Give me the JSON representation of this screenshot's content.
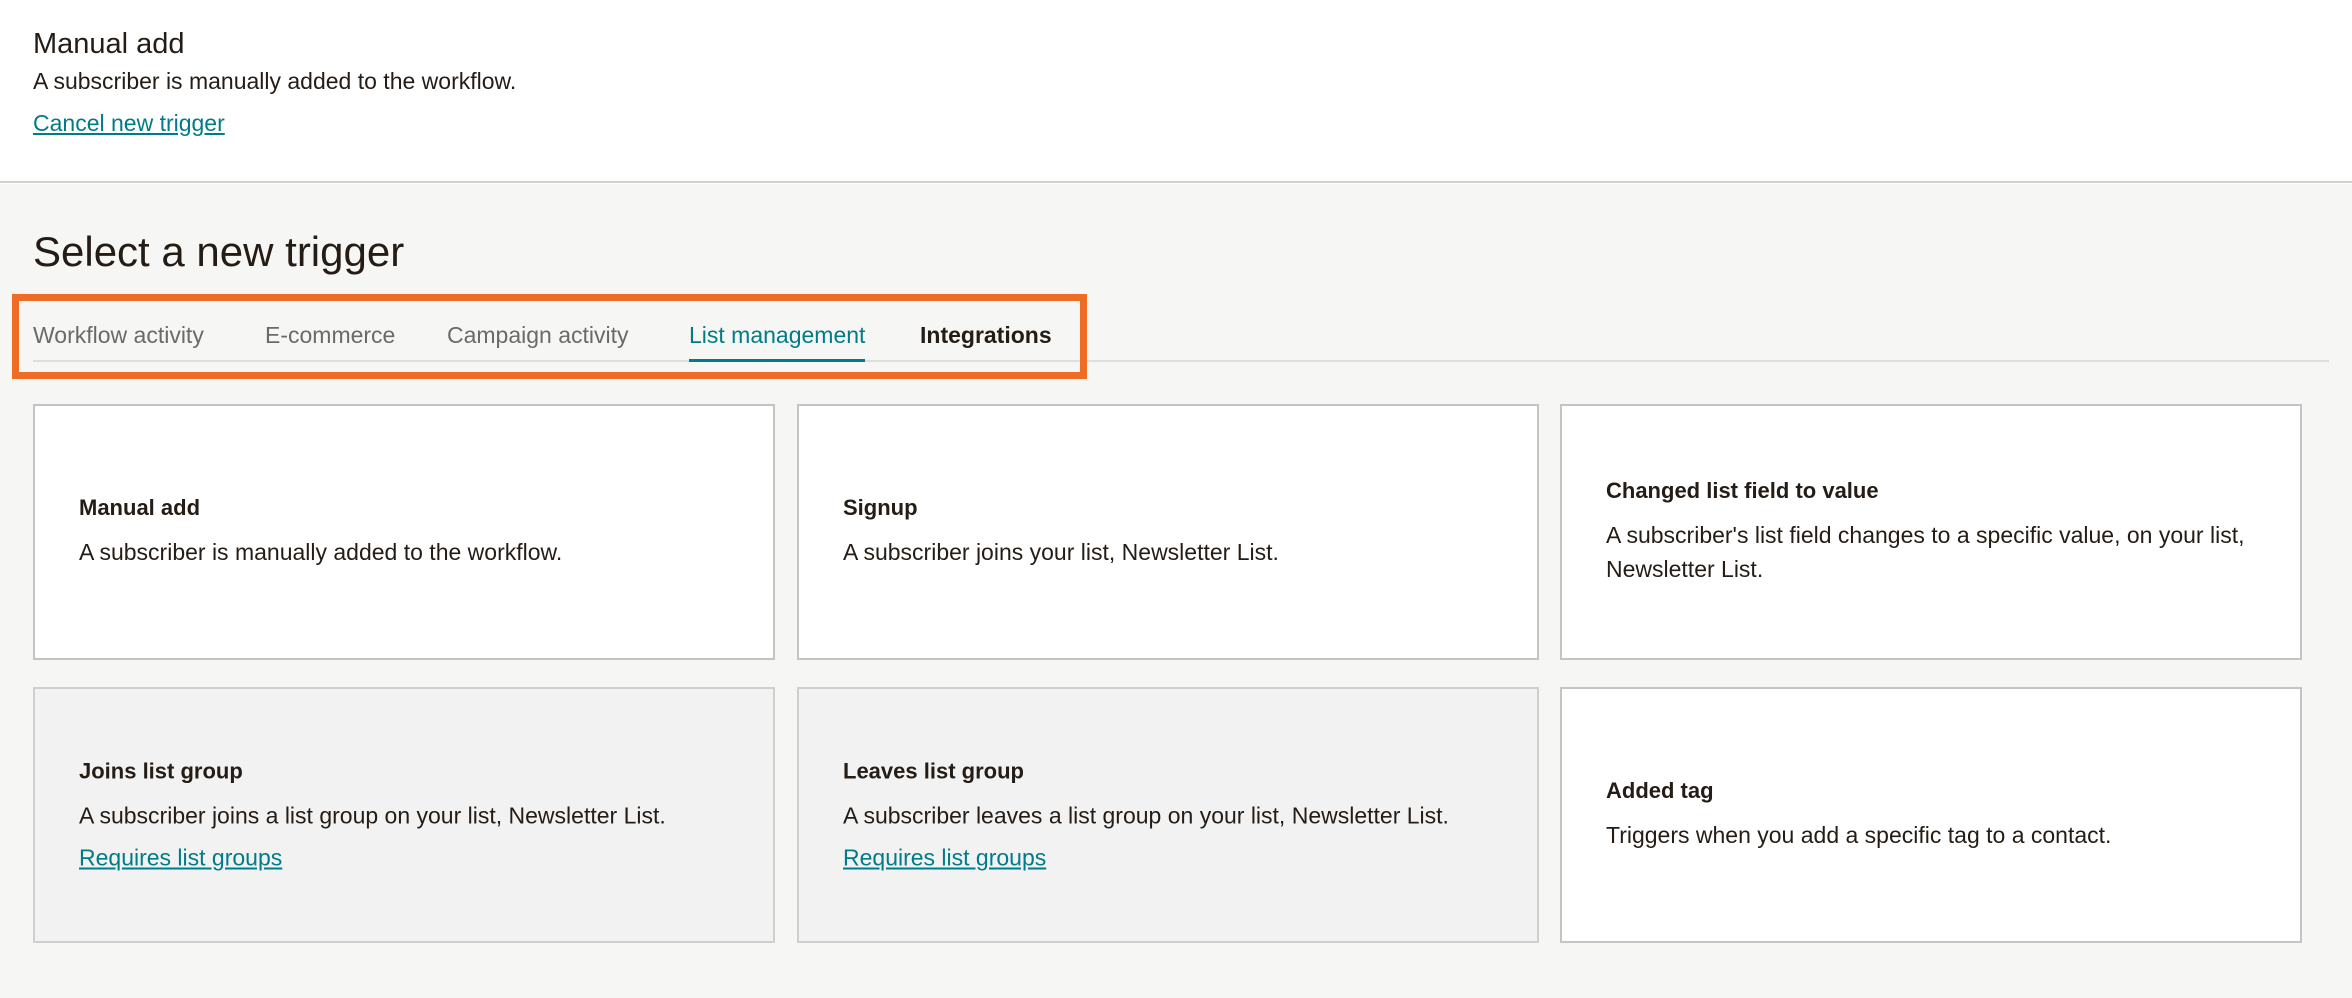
{
  "current_trigger": {
    "title": "Manual add",
    "description": "A subscriber is manually added to the workflow.",
    "cancel_label": "Cancel new trigger"
  },
  "select_section": {
    "title": "Select a new trigger",
    "tabs": [
      {
        "label": "Workflow activity",
        "state": "default"
      },
      {
        "label": "E-commerce",
        "state": "default"
      },
      {
        "label": "Campaign activity",
        "state": "default"
      },
      {
        "label": "List management",
        "state": "active"
      },
      {
        "label": "Integrations",
        "state": "bold"
      }
    ]
  },
  "cards": [
    {
      "title": "Manual add",
      "description": "A subscriber is manually added to the workflow.",
      "link": "",
      "disabled": false
    },
    {
      "title": "Signup",
      "description": "A subscriber joins your list, Newsletter List.",
      "link": "",
      "disabled": false
    },
    {
      "title": "Changed list field to value",
      "description": "A subscriber's list field changes to a specific value, on your list, Newsletter List.",
      "link": "",
      "disabled": false
    },
    {
      "title": "Joins list group",
      "description": "A subscriber joins a list group on your list, Newsletter List.",
      "link": "Requires list groups",
      "disabled": true
    },
    {
      "title": "Leaves list group",
      "description": "A subscriber leaves a list group on your list, Newsletter List.",
      "link": "Requires list groups",
      "disabled": true
    },
    {
      "title": "Added tag",
      "description": "Triggers when you add a specific tag to a contact.",
      "link": "",
      "disabled": false
    }
  ],
  "colors": {
    "accent": "#007c89",
    "highlight": "#ef6c26"
  }
}
